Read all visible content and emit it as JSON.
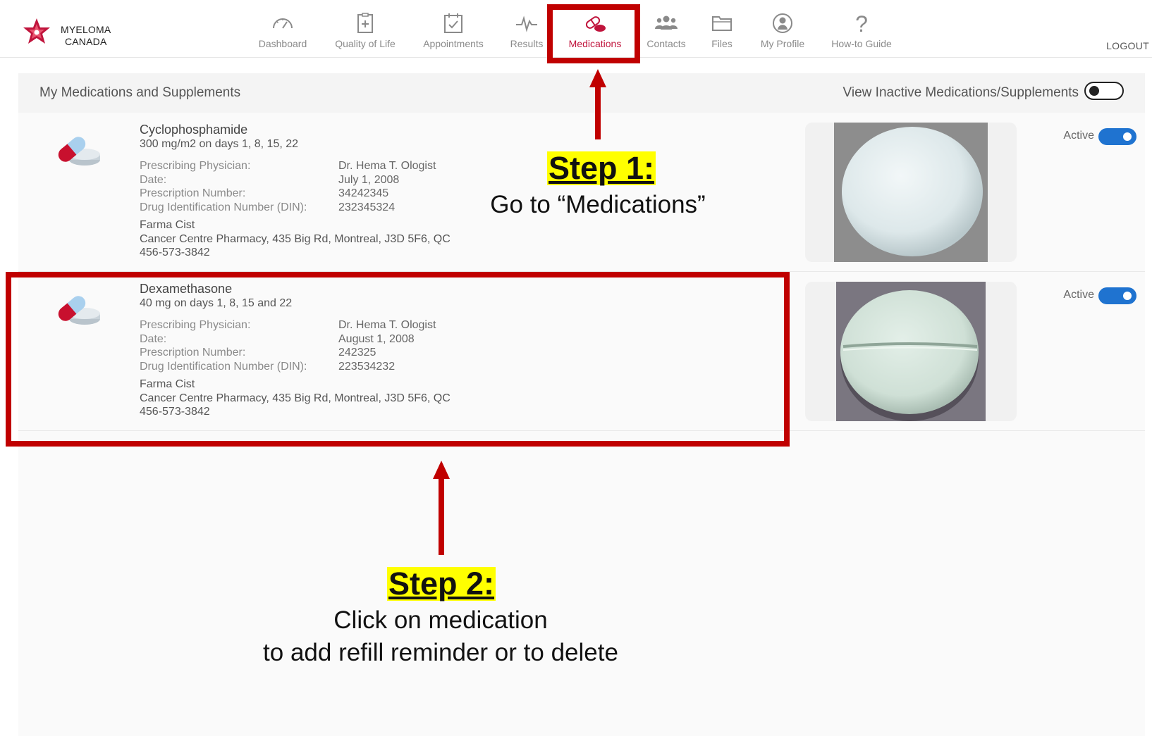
{
  "brand": {
    "line1": "MYELOMA",
    "line2": "CANADA"
  },
  "nav": {
    "items": [
      {
        "label": "Dashboard",
        "icon": "gauge-icon"
      },
      {
        "label": "Quality of Life",
        "icon": "clipboard-plus-icon"
      },
      {
        "label": "Appointments",
        "icon": "calendar-check-icon"
      },
      {
        "label": "Results",
        "icon": "pulse-icon"
      },
      {
        "label": "Medications",
        "icon": "pill-icon",
        "active": true
      },
      {
        "label": "Contacts",
        "icon": "people-icon"
      },
      {
        "label": "Files",
        "icon": "folder-icon"
      },
      {
        "label": "My Profile",
        "icon": "profile-icon"
      },
      {
        "label": "How-to Guide",
        "icon": "question-icon"
      }
    ],
    "logout": "LOGOUT"
  },
  "panel": {
    "title": "My Medications and Supplements",
    "inactive_toggle_label": "View Inactive Medications/Supplements"
  },
  "medications": [
    {
      "name": "Cyclophosphamide",
      "dose": "300 mg/m2 on days 1, 8, 15, 22",
      "fields": [
        {
          "label": "Prescribing Physician:",
          "value": "Dr. Hema T. Ologist"
        },
        {
          "label": "Date:",
          "value": "July 1, 2008"
        },
        {
          "label": "Prescription Number:",
          "value": "34242345"
        },
        {
          "label": "Drug Identification Number (DIN):",
          "value": "232345324"
        }
      ],
      "pharmacy_name": "Farma Cist",
      "pharmacy_address": "Cancer Centre Pharmacy, 435 Big Rd, Montreal, J3D 5F6, QC",
      "pharmacy_phone": "456-573-3842",
      "status": "Active"
    },
    {
      "name": "Dexamethasone",
      "dose": "40 mg on days 1, 8, 15 and 22",
      "fields": [
        {
          "label": "Prescribing Physician:",
          "value": "Dr. Hema T. Ologist"
        },
        {
          "label": "Date:",
          "value": "August 1, 2008"
        },
        {
          "label": "Prescription Number:",
          "value": "242325"
        },
        {
          "label": "Drug Identification Number (DIN):",
          "value": "223534232"
        }
      ],
      "pharmacy_name": "Farma Cist",
      "pharmacy_address": "Cancer Centre Pharmacy, 435 Big Rd, Montreal, J3D 5F6, QC",
      "pharmacy_phone": "456-573-3842",
      "status": "Active"
    }
  ],
  "annotations": {
    "step1": {
      "title": "Step 1:",
      "text": "Go to “Medications”"
    },
    "step2": {
      "title": "Step 2:",
      "line1": "Click on medication",
      "line2": "to add refill reminder or to delete"
    }
  },
  "colors": {
    "accent": "#c0143c",
    "annotation_red": "#c00000",
    "highlight": "#ffff00",
    "toggle_blue": "#1f73d0"
  }
}
